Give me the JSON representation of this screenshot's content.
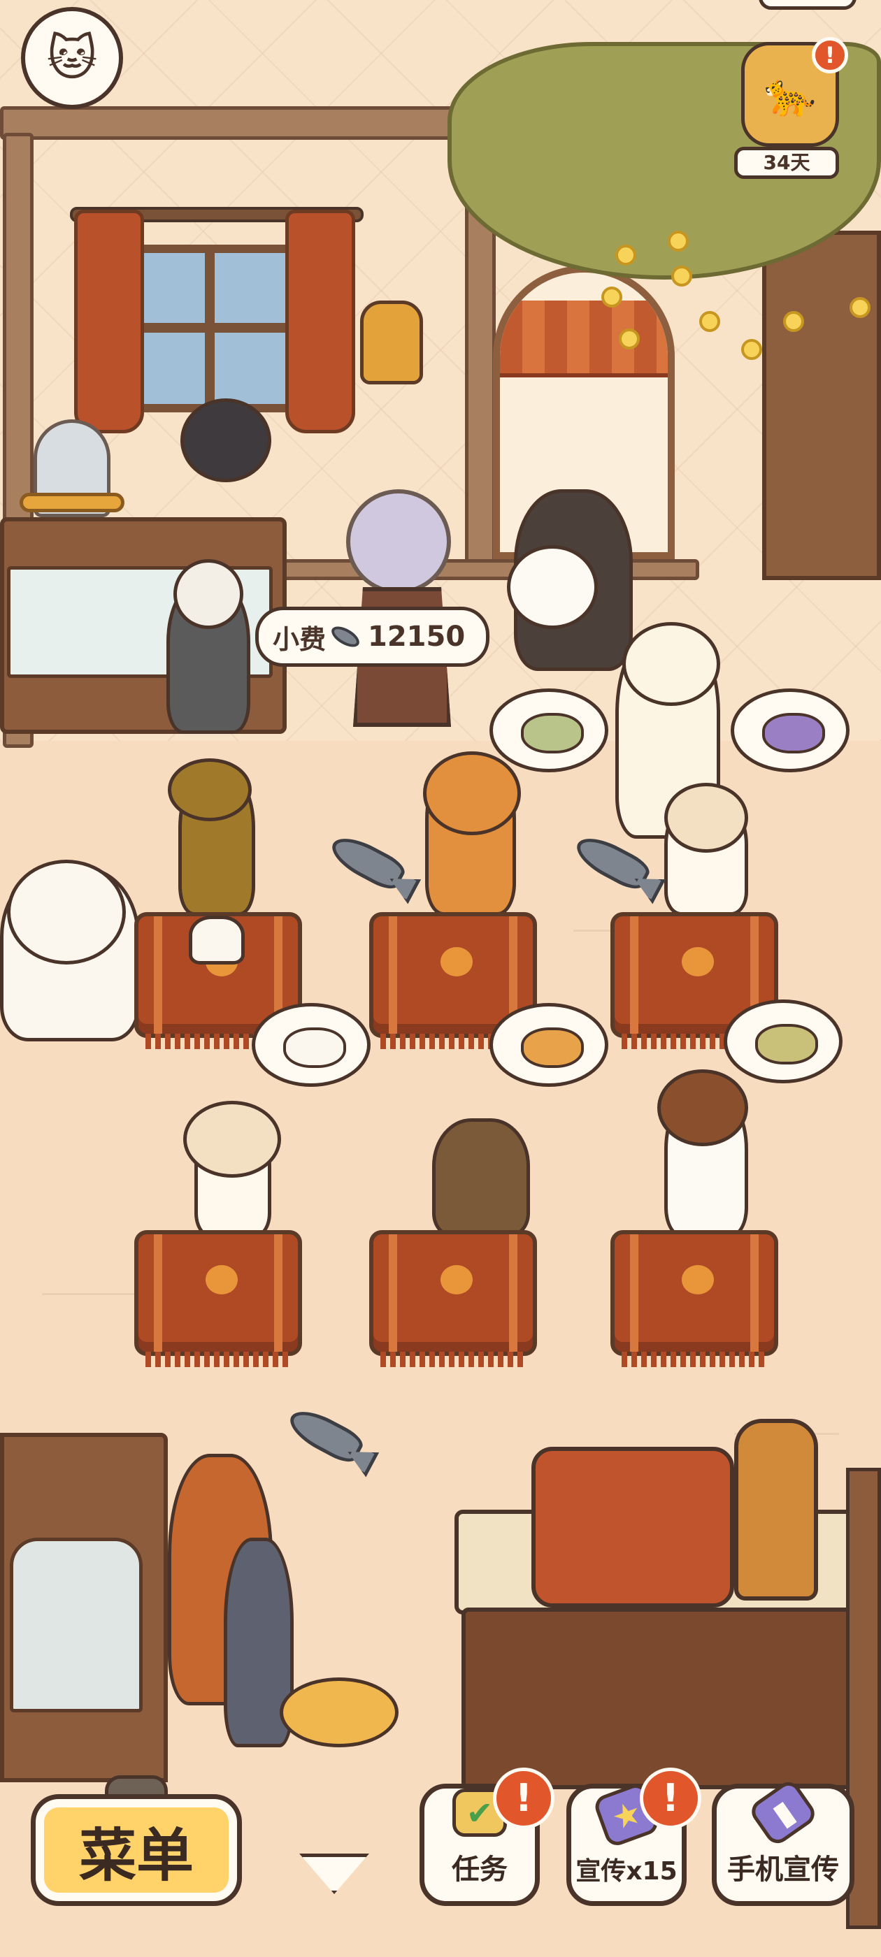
{
  "hud": {
    "days_label": "34天",
    "tip_label": "小费",
    "tip_amount": "12150",
    "alert_mark": "!"
  },
  "bottom_bar": {
    "menu_label": "菜单",
    "tasks_label": "任务",
    "promo_label": "宣传x15",
    "phone_promo_label": "手机宣传"
  },
  "colors": {
    "accent_yellow": "#ffd36a",
    "alert_red": "#e2562c",
    "table_red": "#b04a25",
    "outline_brown": "#4a3328"
  },
  "icons": {
    "avatar": "cat-avatar-icon",
    "event": "event-character-icon",
    "tasks": "checkbox-icon",
    "promo": "flyer-icon",
    "phone": "phone-icon",
    "currency": "fish-icon"
  }
}
